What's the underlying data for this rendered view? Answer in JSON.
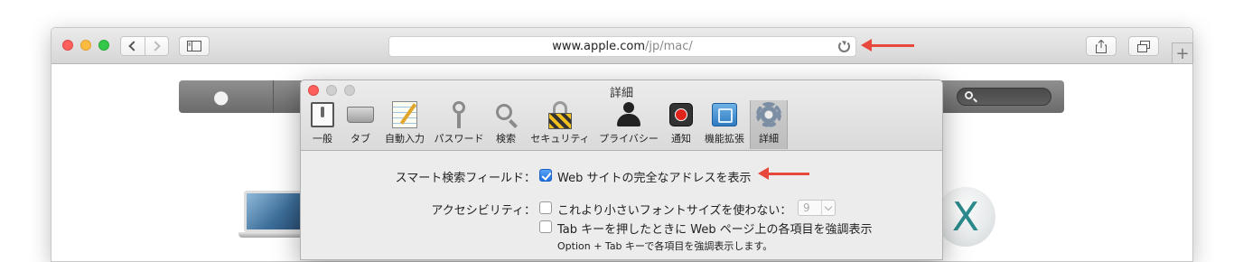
{
  "browser": {
    "url_host": "www.apple.com",
    "url_path": "/jp/mac/",
    "new_tab_symbol": "+",
    "icons": {
      "back": "chevron-left-icon",
      "forward": "chevron-right-icon",
      "sidebar": "sidebar-icon",
      "reload": "reload-icon",
      "share": "share-icon",
      "tabs_overview": "tabs-overview-icon"
    }
  },
  "page": {
    "apple_logo": "",
    "osx_letter": "X"
  },
  "preferences": {
    "title": "詳細",
    "tabs": [
      {
        "label": "一般",
        "icon": "general-switch-icon"
      },
      {
        "label": "タブ",
        "icon": "tabs-icon"
      },
      {
        "label": "自動入力",
        "icon": "autofill-icon"
      },
      {
        "label": "パスワード",
        "icon": "key-icon"
      },
      {
        "label": "検索",
        "icon": "magnifier-icon"
      },
      {
        "label": "セキュリティ",
        "icon": "lock-icon"
      },
      {
        "label": "プライバシー",
        "icon": "privacy-silhouette-icon"
      },
      {
        "label": "通知",
        "icon": "notification-icon"
      },
      {
        "label": "機能拡張",
        "icon": "puzzle-icon"
      },
      {
        "label": "詳細",
        "icon": "gear-icon",
        "selected": true
      }
    ],
    "smart_search_label": "スマート検索フィールド：",
    "smart_search_option": "Web サイトの完全なアドレスを表示",
    "smart_search_checked": true,
    "accessibility_label": "アクセシビリティ：",
    "min_font_option": "これより小さいフォントサイズを使わない：",
    "min_font_checked": false,
    "min_font_value": "9",
    "tab_highlight_option": "Tab キーを押したときに Web ページ上の各項目を強調表示",
    "tab_highlight_checked": false,
    "tab_highlight_note": "Option + Tab キーで各項目を強調表示します。"
  },
  "colors": {
    "annotation_arrow": "#e8473c",
    "checkbox_accent": "#1d6fe0"
  }
}
